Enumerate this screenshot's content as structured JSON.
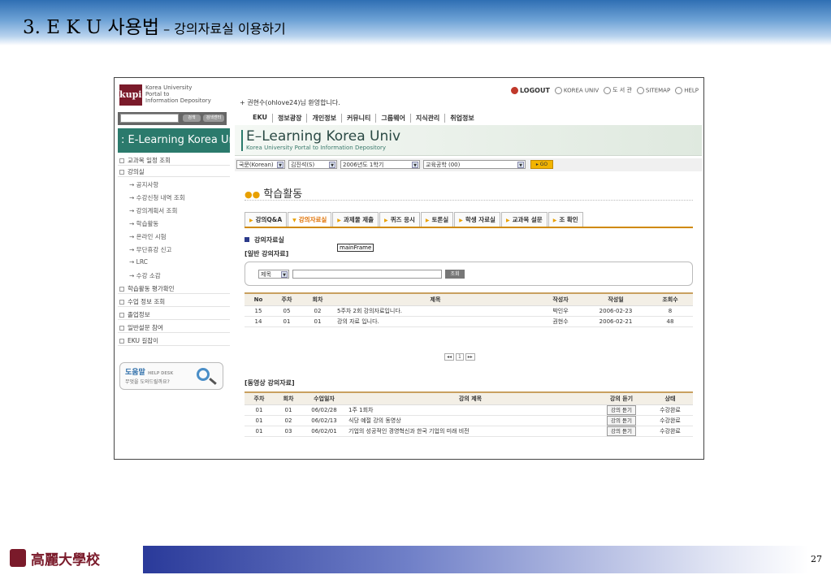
{
  "slide": {
    "title_main": "3. E K U 사용법",
    "title_sub": " – 강의자료실 이용하기",
    "page_number": "27",
    "footer_university": "高麗大學校"
  },
  "portal": {
    "logo_text": "kupid",
    "logo_lines": [
      "Korea University",
      "Portal to",
      "Information Depository"
    ],
    "welcome": "+ 권현수(ohlove24)님 환영합니다.",
    "util_links": [
      "LOGOUT",
      "KOREA UNIV",
      "도 서 관",
      "SITEMAP",
      "HELP"
    ],
    "search_buttons": [
      "검색",
      "검색센터"
    ],
    "top_menu": [
      "EKU",
      "정보광장",
      "개인정보",
      "커뮤니티",
      "그룹웨어",
      "지식관리",
      "취업정보"
    ]
  },
  "sidebar": {
    "title": ": E-Learning Korea Univ",
    "items": [
      "교과목 일정 조회",
      "강의실"
    ],
    "sub_items": [
      "→ 공지사항",
      "→ 수강신청 내역 조회",
      "→ 강의계획서 조회",
      "→ 학습활동",
      "→ 온라인 시험",
      "→ 무단휴강 신고",
      "→ LRC",
      "→ 수강 소감"
    ],
    "items_after": [
      "학습활동 평가확인",
      "수업 정보 조회",
      "졸업정보",
      "일반설문 참여",
      "EKU 길잡이"
    ],
    "help_title": "도움말",
    "help_tag": "HELP DESK",
    "help_sub": "무엇을 도와드릴까요?"
  },
  "banner": {
    "title": "E–Learning Korea Univ",
    "subtitle": "Korea University Portal to Information Depository"
  },
  "selects": {
    "language": "국문(Korean)",
    "user": "김진석(S)",
    "semester": "2006년도 1학기",
    "course": "교육공학 (00)",
    "go": "GO"
  },
  "section": {
    "title": "학습활동",
    "tabs": [
      "강의Q&A",
      "강의자료실",
      "과제물 제출",
      "퀴즈 응시",
      "토론실",
      "학생 자료실",
      "교과목 설문",
      "조 확인"
    ],
    "active_tab": 1,
    "sub_heading": "강의자료실",
    "frame_label": "mainFrame",
    "general_heading": "[일반 강의자료]",
    "search_field": "제목",
    "search_button": "조회"
  },
  "materials_table": {
    "headers": [
      "No",
      "주차",
      "회차",
      "제목",
      "작성자",
      "작성일",
      "조회수"
    ],
    "rows": [
      [
        "15",
        "05",
        "02",
        "5주차 2회 강의자료입니다.",
        "박인우",
        "2006-02-23",
        "8"
      ],
      [
        "14",
        "01",
        "01",
        "강의 자료 입니다.",
        "권현수",
        "2006-02-21",
        "48"
      ]
    ],
    "pager": "1"
  },
  "video": {
    "heading": "[동영상 강의자료]",
    "headers": [
      "주차",
      "회차",
      "수업일자",
      "강의 제목",
      "강의 듣기",
      "상태"
    ],
    "rows": [
      [
        "01",
        "01",
        "06/02/28",
        "1주 1회차",
        "강의 듣기",
        "수강완료"
      ],
      [
        "01",
        "02",
        "06/02/13",
        "식당 예절 강의 동영상",
        "강의 듣기",
        "수강완료"
      ],
      [
        "01",
        "03",
        "06/02/01",
        "기업의 성공적인 경영혁신과 한국 기업의 미래 비전",
        "강의 듣기",
        "수강완료"
      ]
    ]
  }
}
